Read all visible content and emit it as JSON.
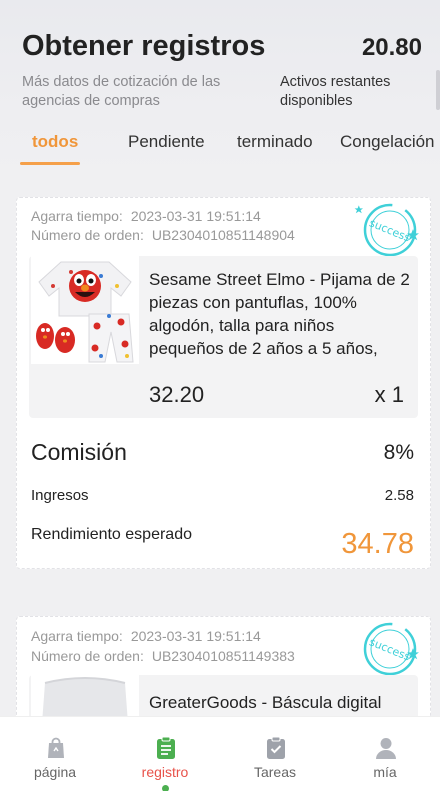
{
  "header": {
    "title": "Obtener registros",
    "balance": "20.80",
    "subtitle": "Más datos de cotización de las agencias de compras",
    "balance_label": "Activos restantes disponibles"
  },
  "tabs": [
    {
      "label": "todos",
      "active": true
    },
    {
      "label": "Pendiente",
      "active": false
    },
    {
      "label": "terminado",
      "active": false
    },
    {
      "label": "Congelación",
      "active": false
    }
  ],
  "orders": [
    {
      "time_label": "Agarra tiempo:",
      "time": "2023-03-31 19:51:14",
      "order_label": "Número de orden:",
      "order_no": "UB2304010851148904",
      "stamp": "success",
      "product_name": "Sesame Street Elmo - Pijama de 2 piezas con pantuflas, 100% algodón, talla para niños pequeños de 2 años a 5 años,",
      "price": "32.20",
      "quantity": "x 1",
      "commission_label": "Comisión",
      "commission": "8%",
      "income_label": "Ingresos",
      "income": "2.58",
      "expected_label": "Rendimiento esperado",
      "expected": "34.78"
    },
    {
      "time_label": "Agarra tiempo:",
      "time": "2023-03-31 19:51:14",
      "order_label": "Número de orden:",
      "order_no": "UB2304010851149383",
      "stamp": "success",
      "product_name": "GreaterGoods - Báscula digital"
    }
  ],
  "bottom_nav": [
    {
      "label": "página",
      "icon": "bag-icon",
      "active": false
    },
    {
      "label": "registro",
      "icon": "clipboard-icon",
      "active": true
    },
    {
      "label": "Tareas",
      "icon": "task-check-icon",
      "active": false
    },
    {
      "label": "mía",
      "icon": "user-icon",
      "active": false
    }
  ],
  "colors": {
    "accent_orange": "#f0963a",
    "stamp_cyan": "#3fd0d8",
    "nav_active_red": "#e8524a",
    "nav_active_green": "#4caf50"
  }
}
